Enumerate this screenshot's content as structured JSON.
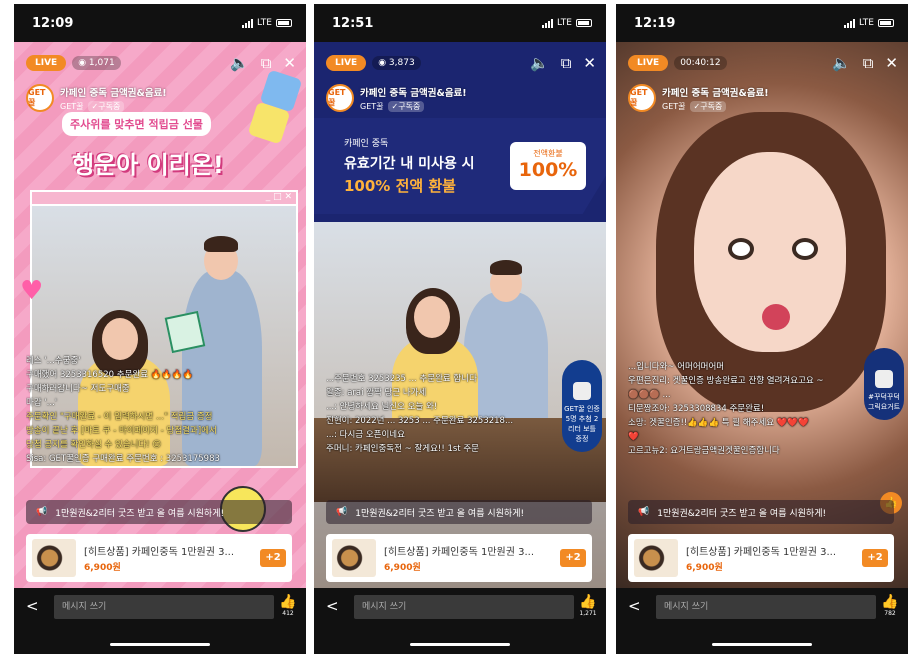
{
  "status": {
    "times": [
      "12:09",
      "12:51",
      "12:19"
    ],
    "carrier": "LTE"
  },
  "common": {
    "live_label": "LIVE",
    "channel_title": "카페인 중독 금액권&음료!",
    "channel_name": "GET꿀",
    "subscribed_label": "✓구독중",
    "avatar_text": "GET꿀",
    "notice_text": "1만원권&2리터 굿즈 받고 올 여름 시원하게!",
    "product_name": "[히트상품] 카페인중독 1만원권 3...",
    "product_price": "6,900원",
    "product_more": "+2",
    "message_placeholder": "메시지 쓰기"
  },
  "phones": [
    {
      "viewers": "1,071",
      "likes": "412",
      "promo_sub": "주사위를 맞추면 적립금 선물",
      "promo_big": "행운아 이리온!",
      "chat": [
        "레스 '...수궁중'",
        "구매했어 3253316520 추문완료 🔥🔥🔥🔥",
        "구매하러갑니다~ 저도구매중",
        "마감 '...'",
        "주문확인 \"구매완료 - 이 입력하시면 ...\" 적립금 증정",
        "방송이 끝난 후 [마토 쿠 - 마이페이지 - 당첨결과]에서",
        "당첨 공지를 확인하실 수 있습니다! 😊",
        "Sisa: GET꿀인증 구매완료 주문번호 : 3253175983"
      ]
    },
    {
      "viewers": "3,873",
      "likes": "1,271",
      "banner_line1": "카페인 중독",
      "banner_line2": "유효기간 내 미사용 시",
      "banner_line3": "100% 전액 환불",
      "coupon_label": "전액환불",
      "coupon_value": "100%",
      "side_promo": "GET꿀 인증 5명 추첨 2리터 보틀 증정",
      "chat": [
        "...주문번호 3253235 ... 추문완료 합니다",
        "알종: arai 깜짝 당근 나가세",
        "...: 안녕하세요 닐신오 오늘 와!",
        "진현이: 2022년 ... 3253 ... 주문완료 3253218...",
        "...: 다시금 오픈이네요",
        "주머니: 카페인중독전 ~ 잘게요!! 1st 주문"
      ]
    },
    {
      "timer": "00:40:12",
      "likes": "782",
      "side_promo": "#꾸덕꾸덕 그릭요거트",
      "chat": [
        "...입니다와~ 어머어머어머",
        "우편은진리: 겟꿀인증 방송완료고 잔향 열려겨요고요 ~",
        "🟤🟤🟤 ...",
        "티문짱조아: 3253308834 주문완료!",
        "소망: 겟꿀인증!!👍👍👍 특 필 해주세요 ❤️❤️❤️",
        "❤️",
        "고르고뉴2: 요거트랑금액권겟꿀인증합니다"
      ]
    }
  ]
}
